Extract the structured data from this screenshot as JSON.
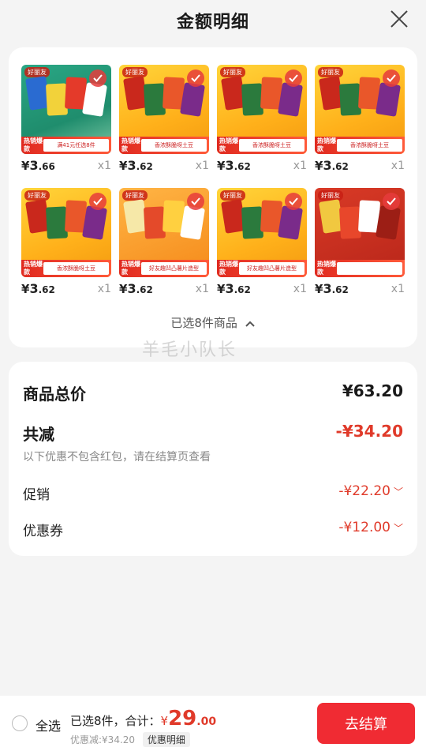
{
  "header": {
    "title": "金额明细"
  },
  "products": {
    "items": [
      {
        "price_int": "3",
        "price_dec": ".66",
        "qty": "x1",
        "desc": "满41元任选8件",
        "style": "green"
      },
      {
        "price_int": "3",
        "price_dec": ".62",
        "qty": "x1",
        "desc": "香浓酥脆呀土豆",
        "style": "yellow"
      },
      {
        "price_int": "3",
        "price_dec": ".62",
        "qty": "x1",
        "desc": "香浓酥脆呀土豆",
        "style": "yellow"
      },
      {
        "price_int": "3",
        "price_dec": ".62",
        "qty": "x1",
        "desc": "香浓酥脆呀土豆",
        "style": "yellow"
      },
      {
        "price_int": "3",
        "price_dec": ".62",
        "qty": "x1",
        "desc": "香浓酥脆呀土豆",
        "style": "yellow"
      },
      {
        "price_int": "3",
        "price_dec": ".62",
        "qty": "x1",
        "desc": "好友趣凹凸薯片造型",
        "style": "orange"
      },
      {
        "price_int": "3",
        "price_dec": ".62",
        "qty": "x1",
        "desc": "好友趣凹凸薯片造型",
        "style": "yellow"
      },
      {
        "price_int": "3",
        "price_dec": ".62",
        "qty": "x1",
        "desc": "",
        "style": "red"
      }
    ],
    "currency": "¥",
    "logo": "好丽友",
    "hot_label": "热销爆款",
    "selected_text": "已选8件商品"
  },
  "watermark": "羊毛小队长",
  "summary": {
    "total_label": "商品总价",
    "total_value": "¥63.20",
    "reduce_label": "共减",
    "reduce_value": "-¥34.20",
    "note": "以下优惠不包含红包，请在结算页查看",
    "promo_label": "促销",
    "promo_value": "-¥22.20",
    "coupon_label": "优惠券",
    "coupon_value": "-¥12.00"
  },
  "footer": {
    "select_all": "全选",
    "summary_prefix": "已选8件，合计：",
    "currency": "¥",
    "total_int": "29",
    "total_dec": ".00",
    "discount_text": "优惠减:¥34.20",
    "detail_label": "优惠明细",
    "checkout_label": "去结算"
  },
  "colors": {
    "accent": "#e03a2a",
    "checkout": "#f02b33"
  }
}
